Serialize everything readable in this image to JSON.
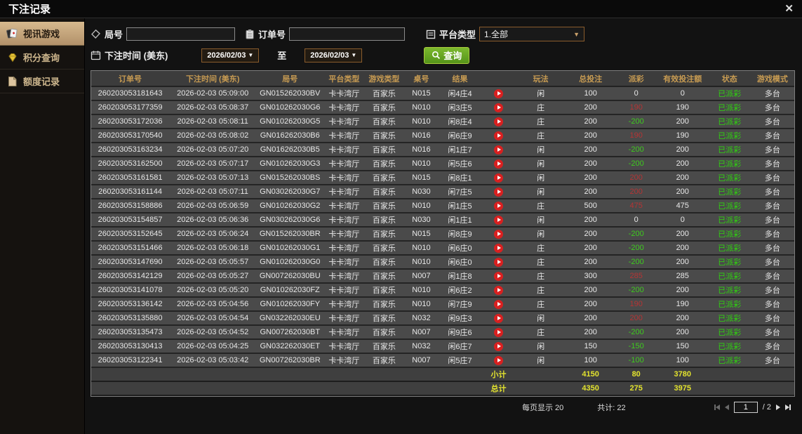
{
  "window": {
    "title": "下注记录",
    "close_glyph": "✕"
  },
  "sidebar": {
    "items": [
      {
        "label": "视讯游戏",
        "icon": "cards-icon",
        "active": true
      },
      {
        "label": "积分查询",
        "icon": "gem-icon",
        "active": false
      },
      {
        "label": "额度记录",
        "icon": "document-icon",
        "active": false
      }
    ]
  },
  "filters": {
    "round_label": "局号",
    "order_label": "订单号",
    "platform_label": "平台类型",
    "platform_value": "1.全部",
    "bet_time_label": "下注时间 (美东)",
    "date_from": "2026/02/03",
    "to_label": "至",
    "date_to": "2026/02/03",
    "search_label": "查询"
  },
  "table": {
    "headers": [
      "订单号",
      "下注时间 (美东)",
      "局号",
      "平台类型",
      "游戏类型",
      "桌号",
      "结果",
      "",
      "玩法",
      "总投注",
      "派彩",
      "有效投注额",
      "状态",
      "游戏模式"
    ],
    "rows": [
      {
        "order_id": "260203053181643",
        "time": "2026-02-03 05:09:00",
        "round": "GN015262030BV",
        "platform": "卡卡湾厅",
        "game": "百家乐",
        "table_no": "N015",
        "result": "闲4庄4",
        "play": "闲",
        "total_bet": "100",
        "payout": "0",
        "payout_class": "zero",
        "valid_bet": "0",
        "status": "已派彩",
        "mode": "多台"
      },
      {
        "order_id": "260203053177359",
        "time": "2026-02-03 05:08:37",
        "round": "GN010262030G6",
        "platform": "卡卡湾厅",
        "game": "百家乐",
        "table_no": "N010",
        "result": "闲3庄5",
        "play": "庄",
        "total_bet": "200",
        "payout": "190",
        "payout_class": "pos",
        "valid_bet": "190",
        "status": "已派彩",
        "mode": "多台"
      },
      {
        "order_id": "260203053172036",
        "time": "2026-02-03 05:08:11",
        "round": "GN010262030G5",
        "platform": "卡卡湾厅",
        "game": "百家乐",
        "table_no": "N010",
        "result": "闲8庄4",
        "play": "庄",
        "total_bet": "200",
        "payout": "-200",
        "payout_class": "neg",
        "valid_bet": "200",
        "status": "已派彩",
        "mode": "多台"
      },
      {
        "order_id": "260203053170540",
        "time": "2026-02-03 05:08:02",
        "round": "GN016262030B6",
        "platform": "卡卡湾厅",
        "game": "百家乐",
        "table_no": "N016",
        "result": "闲6庄9",
        "play": "庄",
        "total_bet": "200",
        "payout": "190",
        "payout_class": "pos",
        "valid_bet": "190",
        "status": "已派彩",
        "mode": "多台"
      },
      {
        "order_id": "260203053163234",
        "time": "2026-02-03 05:07:20",
        "round": "GN016262030B5",
        "platform": "卡卡湾厅",
        "game": "百家乐",
        "table_no": "N016",
        "result": "闲1庄7",
        "play": "闲",
        "total_bet": "200",
        "payout": "-200",
        "payout_class": "neg",
        "valid_bet": "200",
        "status": "已派彩",
        "mode": "多台"
      },
      {
        "order_id": "260203053162500",
        "time": "2026-02-03 05:07:17",
        "round": "GN010262030G3",
        "platform": "卡卡湾厅",
        "game": "百家乐",
        "table_no": "N010",
        "result": "闲5庄6",
        "play": "闲",
        "total_bet": "200",
        "payout": "-200",
        "payout_class": "neg",
        "valid_bet": "200",
        "status": "已派彩",
        "mode": "多台"
      },
      {
        "order_id": "260203053161581",
        "time": "2026-02-03 05:07:13",
        "round": "GN015262030BS",
        "platform": "卡卡湾厅",
        "game": "百家乐",
        "table_no": "N015",
        "result": "闲8庄1",
        "play": "闲",
        "total_bet": "200",
        "payout": "200",
        "payout_class": "pos",
        "valid_bet": "200",
        "status": "已派彩",
        "mode": "多台"
      },
      {
        "order_id": "260203053161144",
        "time": "2026-02-03 05:07:11",
        "round": "GN030262030G7",
        "platform": "卡卡湾厅",
        "game": "百家乐",
        "table_no": "N030",
        "result": "闲7庄5",
        "play": "闲",
        "total_bet": "200",
        "payout": "200",
        "payout_class": "pos",
        "valid_bet": "200",
        "status": "已派彩",
        "mode": "多台"
      },
      {
        "order_id": "260203053158886",
        "time": "2026-02-03 05:06:59",
        "round": "GN010262030G2",
        "platform": "卡卡湾厅",
        "game": "百家乐",
        "table_no": "N010",
        "result": "闲1庄5",
        "play": "庄",
        "total_bet": "500",
        "payout": "475",
        "payout_class": "pos",
        "valid_bet": "475",
        "status": "已派彩",
        "mode": "多台"
      },
      {
        "order_id": "260203053154857",
        "time": "2026-02-03 05:06:36",
        "round": "GN030262030G6",
        "platform": "卡卡湾厅",
        "game": "百家乐",
        "table_no": "N030",
        "result": "闲1庄1",
        "play": "闲",
        "total_bet": "200",
        "payout": "0",
        "payout_class": "zero",
        "valid_bet": "0",
        "status": "已派彩",
        "mode": "多台"
      },
      {
        "order_id": "260203053152645",
        "time": "2026-02-03 05:06:24",
        "round": "GN015262030BR",
        "platform": "卡卡湾厅",
        "game": "百家乐",
        "table_no": "N015",
        "result": "闲8庄9",
        "play": "闲",
        "total_bet": "200",
        "payout": "-200",
        "payout_class": "neg",
        "valid_bet": "200",
        "status": "已派彩",
        "mode": "多台"
      },
      {
        "order_id": "260203053151466",
        "time": "2026-02-03 05:06:18",
        "round": "GN010262030G1",
        "platform": "卡卡湾厅",
        "game": "百家乐",
        "table_no": "N010",
        "result": "闲6庄0",
        "play": "庄",
        "total_bet": "200",
        "payout": "-200",
        "payout_class": "neg",
        "valid_bet": "200",
        "status": "已派彩",
        "mode": "多台"
      },
      {
        "order_id": "260203053147690",
        "time": "2026-02-03 05:05:57",
        "round": "GN010262030G0",
        "platform": "卡卡湾厅",
        "game": "百家乐",
        "table_no": "N010",
        "result": "闲6庄0",
        "play": "庄",
        "total_bet": "200",
        "payout": "-200",
        "payout_class": "neg",
        "valid_bet": "200",
        "status": "已派彩",
        "mode": "多台"
      },
      {
        "order_id": "260203053142129",
        "time": "2026-02-03 05:05:27",
        "round": "GN007262030BU",
        "platform": "卡卡湾厅",
        "game": "百家乐",
        "table_no": "N007",
        "result": "闲1庄8",
        "play": "庄",
        "total_bet": "300",
        "payout": "285",
        "payout_class": "pos",
        "valid_bet": "285",
        "status": "已派彩",
        "mode": "多台"
      },
      {
        "order_id": "260203053141078",
        "time": "2026-02-03 05:05:20",
        "round": "GN010262030FZ",
        "platform": "卡卡湾厅",
        "game": "百家乐",
        "table_no": "N010",
        "result": "闲6庄2",
        "play": "庄",
        "total_bet": "200",
        "payout": "-200",
        "payout_class": "neg",
        "valid_bet": "200",
        "status": "已派彩",
        "mode": "多台"
      },
      {
        "order_id": "260203053136142",
        "time": "2026-02-03 05:04:56",
        "round": "GN010262030FY",
        "platform": "卡卡湾厅",
        "game": "百家乐",
        "table_no": "N010",
        "result": "闲7庄9",
        "play": "庄",
        "total_bet": "200",
        "payout": "190",
        "payout_class": "pos",
        "valid_bet": "190",
        "status": "已派彩",
        "mode": "多台"
      },
      {
        "order_id": "260203053135880",
        "time": "2026-02-03 05:04:54",
        "round": "GN032262030EU",
        "platform": "卡卡湾厅",
        "game": "百家乐",
        "table_no": "N032",
        "result": "闲9庄3",
        "play": "闲",
        "total_bet": "200",
        "payout": "200",
        "payout_class": "pos",
        "valid_bet": "200",
        "status": "已派彩",
        "mode": "多台"
      },
      {
        "order_id": "260203053135473",
        "time": "2026-02-03 05:04:52",
        "round": "GN007262030BT",
        "platform": "卡卡湾厅",
        "game": "百家乐",
        "table_no": "N007",
        "result": "闲9庄6",
        "play": "庄",
        "total_bet": "200",
        "payout": "-200",
        "payout_class": "neg",
        "valid_bet": "200",
        "status": "已派彩",
        "mode": "多台"
      },
      {
        "order_id": "260203053130413",
        "time": "2026-02-03 05:04:25",
        "round": "GN032262030ET",
        "platform": "卡卡湾厅",
        "game": "百家乐",
        "table_no": "N032",
        "result": "闲6庄7",
        "play": "闲",
        "total_bet": "150",
        "payout": "-150",
        "payout_class": "neg",
        "valid_bet": "150",
        "status": "已派彩",
        "mode": "多台"
      },
      {
        "order_id": "260203053122341",
        "time": "2026-02-03 05:03:42",
        "round": "GN007262030BR",
        "platform": "卡卡湾厅",
        "game": "百家乐",
        "table_no": "N007",
        "result": "闲5庄7",
        "play": "闲",
        "total_bet": "100",
        "payout": "-100",
        "payout_class": "neg",
        "valid_bet": "100",
        "status": "已派彩",
        "mode": "多台"
      }
    ],
    "subtotal": {
      "label": "小计",
      "total_bet": "4150",
      "payout": "80",
      "valid_bet": "3780"
    },
    "grand_total": {
      "label": "总计",
      "total_bet": "4350",
      "payout": "275",
      "valid_bet": "3975"
    }
  },
  "footer": {
    "per_page": "每页显示 20",
    "total_count": "共计: 22",
    "page": "1",
    "page_total": "/ 2"
  },
  "colors": {
    "accent_tan": "#c2a171",
    "header_gold": "#c79b52",
    "row_bg": "#4a4a4a",
    "payout_positive": "#b53434",
    "payout_negative": "#3ecb1e",
    "status_paid": "#2fd40f",
    "total_yellow": "#e3e32e",
    "button_green": "#6aaa22",
    "date_border": "#8a5c2c"
  }
}
